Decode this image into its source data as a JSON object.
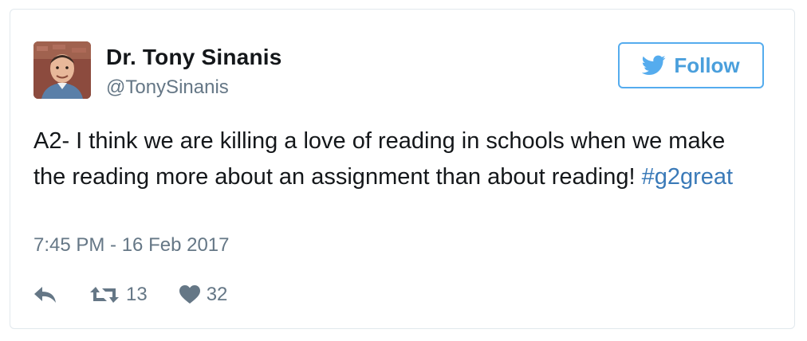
{
  "author": {
    "display_name": "Dr. Tony Sinanis",
    "handle": "@TonySinanis"
  },
  "follow_button": {
    "label": "Follow",
    "icon": "twitter-bird-icon",
    "color": "#55acee"
  },
  "tweet": {
    "text": "A2- I think we are killing a love of reading in schools when we make the reading more about an assignment than about reading! ",
    "hashtag": "#g2great",
    "timestamp": "7:45 PM - 16 Feb 2017"
  },
  "actions": {
    "reply_icon": "reply-icon",
    "retweet_icon": "retweet-icon",
    "retweet_count": "13",
    "like_icon": "heart-icon",
    "like_count": "32"
  },
  "colors": {
    "text": "#14171a",
    "secondary": "#657786",
    "link": "#3a7ab8",
    "border": "#e1e8ed"
  }
}
